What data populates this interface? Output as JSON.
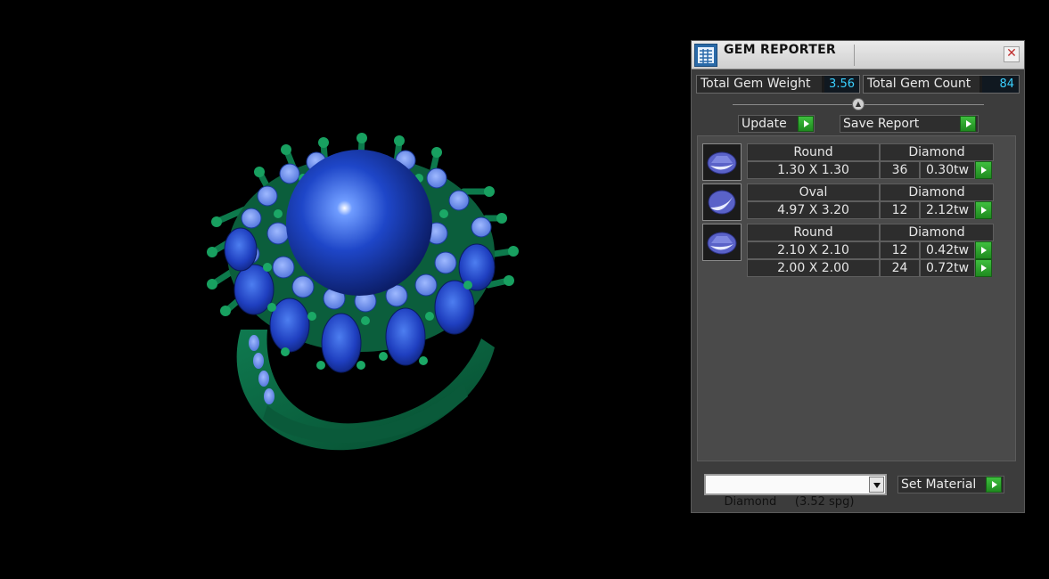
{
  "panel": {
    "title": "GEM REPORTER",
    "close_glyph": "✕",
    "colors": {
      "go_button": "#2fa82f",
      "value_text": "#3ad0ff",
      "panel_bg": "#3c3c3c"
    }
  },
  "stats": {
    "total_gem_weight_label": "Total Gem Weight",
    "total_gem_weight_value": "3.56",
    "total_gem_count_label": "Total Gem Count",
    "total_gem_count_value": "84"
  },
  "toolbar": {
    "update_label": "Update",
    "save_report_label": "Save Report"
  },
  "gem_groups": [
    {
      "shape": "Round",
      "material": "Diamond",
      "rows": [
        {
          "size": "1.30 X 1.30",
          "count": "36",
          "weight": "0.30tw"
        }
      ]
    },
    {
      "shape": "Oval",
      "material": "Diamond",
      "rows": [
        {
          "size": "4.97 X 3.20",
          "count": "12",
          "weight": "2.12tw"
        }
      ]
    },
    {
      "shape": "Round",
      "material": "Diamond",
      "rows": [
        {
          "size": "2.10 X 2.10",
          "count": "12",
          "weight": "0.42tw"
        },
        {
          "size": "2.00 X 2.00",
          "count": "24",
          "weight": "0.72tw"
        }
      ]
    }
  ],
  "material": {
    "selected": "Diamond     (3.52 spg)",
    "set_material_label": "Set Material"
  },
  "icons": {
    "title": "gem-reporter-app-icon",
    "thumb": "gem-thumbnail-icon",
    "go": "green-play-icon",
    "dropdown": "chevron-down-icon"
  }
}
